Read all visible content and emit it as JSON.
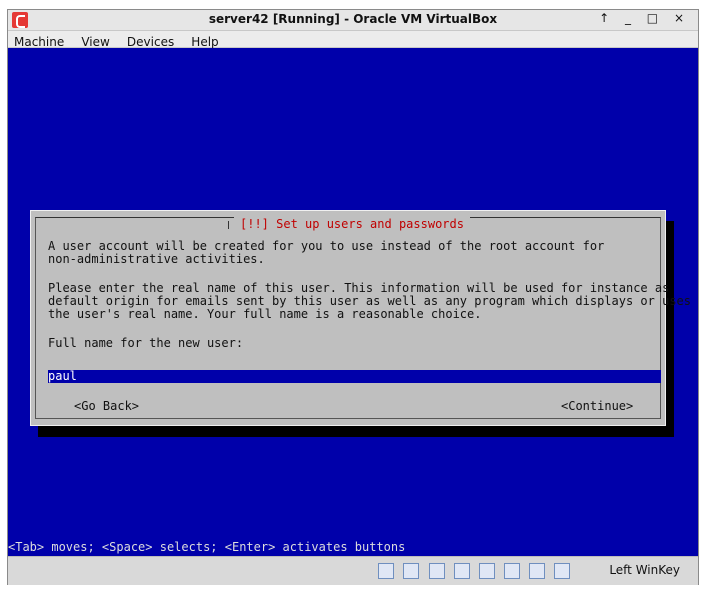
{
  "window": {
    "title": "server42 [Running] - Oracle VM VirtualBox",
    "controls": "↑ _ □ ×"
  },
  "menu": [
    "Machine",
    "View",
    "Devices",
    "Help"
  ],
  "installer": {
    "dialog_title": "[!!] Set up users and passwords",
    "para1": "A user account will be created for you to use instead of the root account for\nnon-administrative activities.",
    "para2": "Please enter the real name of this user. This information will be used for instance as\ndefault origin for emails sent by this user as well as any program which displays or uses\nthe user's real name. Your full name is a reasonable choice.",
    "prompt": "Full name for the new user:",
    "input_value": "paul",
    "go_back": "<Go Back>",
    "continue": "<Continue>",
    "hint": "<Tab> moves; <Space> selects; <Enter> activates buttons"
  },
  "statusbar": {
    "host_key": "Left WinKey",
    "icons": [
      "hard-disk-icon",
      "optical-drive-icon",
      "network-icon",
      "usb-icon",
      "shared-folders-icon",
      "display-icon",
      "mouse-integration-icon",
      "host-key-icon"
    ]
  }
}
